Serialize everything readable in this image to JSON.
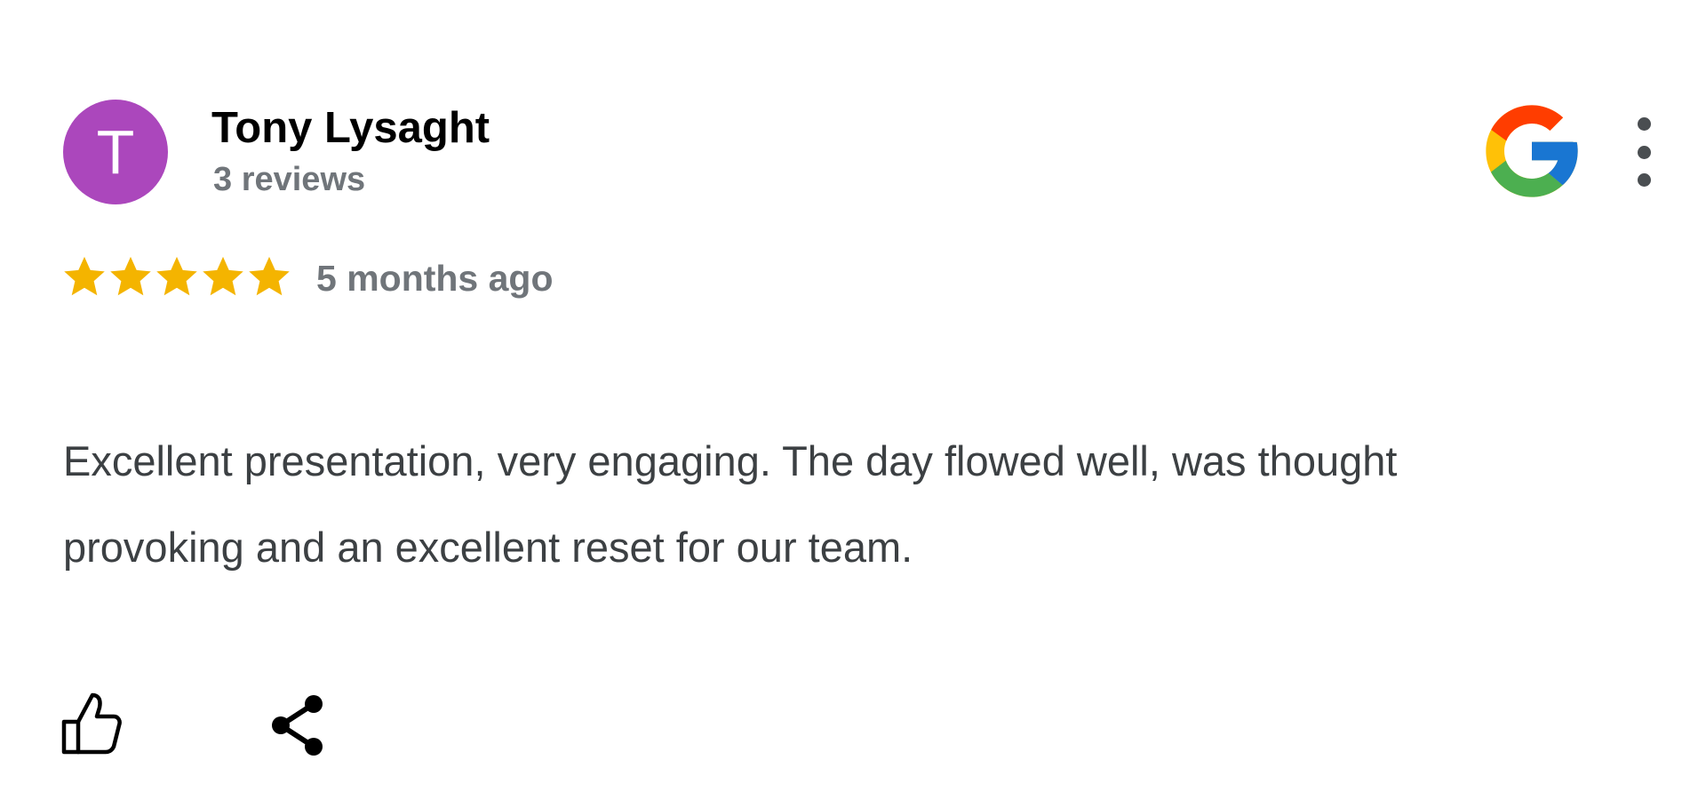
{
  "review": {
    "author": {
      "initial": "T",
      "name": "Tony Lysaght",
      "review_count": "3 reviews",
      "avatar_color": "#ab47bc"
    },
    "source_icon": "google-g-icon",
    "menu_icon": "more-vert-icon",
    "rating": 5,
    "rating_max": 5,
    "star_color": "#f4b400",
    "time_ago": "5 months ago",
    "text": "Excellent presentation, very engaging. The day flowed well, was thought provoking and an excellent reset for our team.",
    "actions": {
      "like_icon": "thumbs-up-icon",
      "share_icon": "share-icon"
    }
  }
}
